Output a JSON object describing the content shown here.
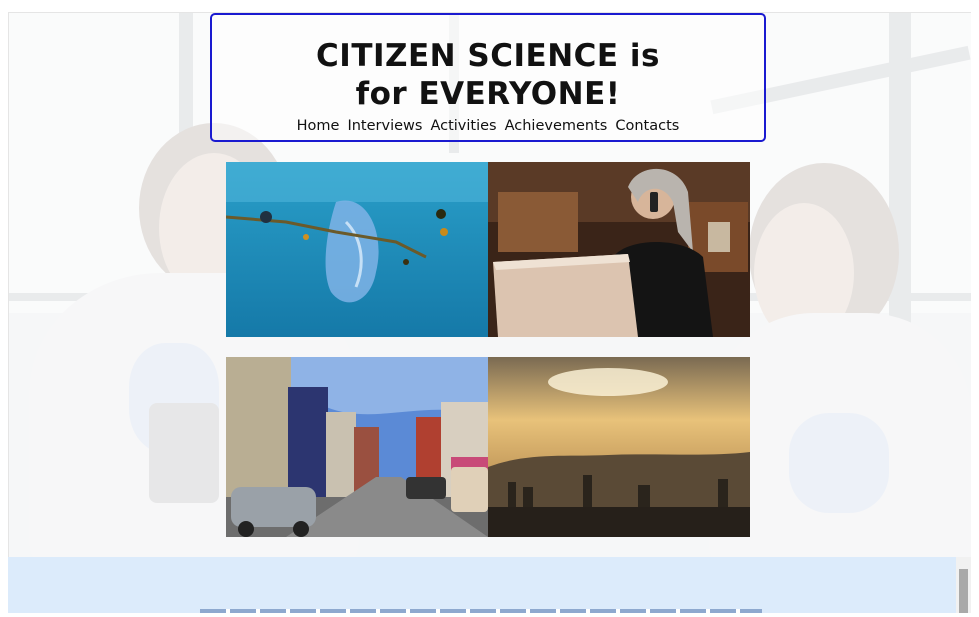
{
  "header": {
    "title": "CITIZEN SCIENCE is for EVERYONE!",
    "nav": [
      "Home",
      "Interviews",
      "Activities",
      "Achievements",
      "Contacts"
    ]
  },
  "gallery": {
    "photos": [
      {
        "subject": "plastic bag floating in ocean"
      },
      {
        "subject": "woman on phone with laptop"
      },
      {
        "subject": "colorful city street with parked cars"
      },
      {
        "subject": "hazy sunset over city skyline"
      }
    ]
  },
  "colors": {
    "header_border": "#1a1ad0",
    "footer_band": "#dcebfb"
  }
}
